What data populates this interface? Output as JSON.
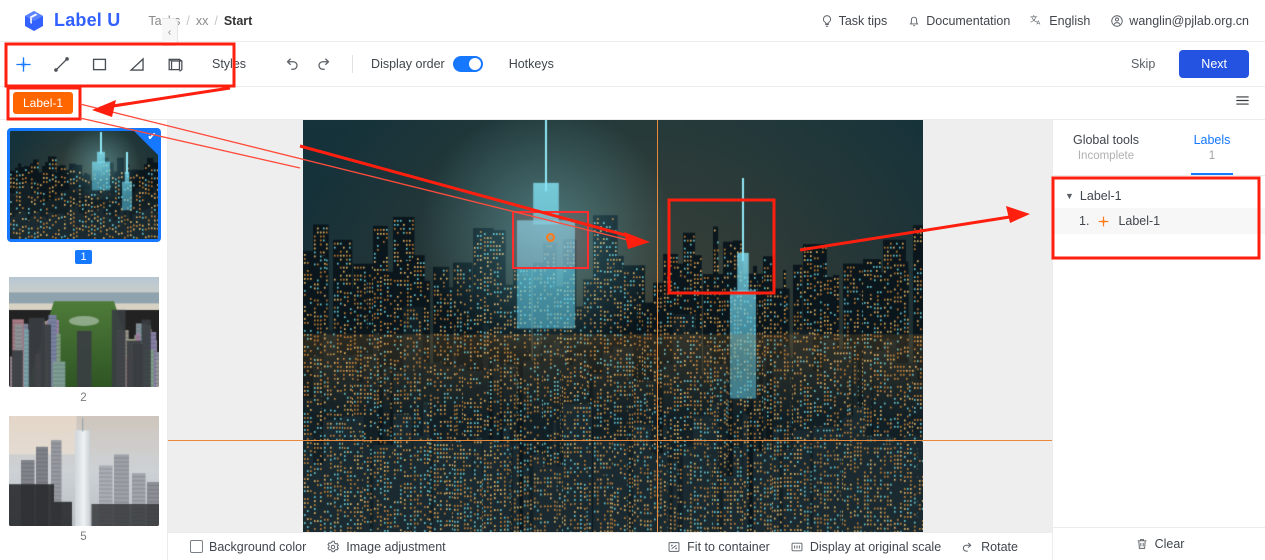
{
  "header": {
    "brand": "Label U",
    "logo_icon": "cube-logo-icon",
    "breadcrumb": {
      "root": "Tasks",
      "middle": "xx",
      "current": "Start",
      "separator": "/"
    },
    "actions": [
      {
        "label": "Task tips",
        "icon": "bulb-icon"
      },
      {
        "label": "Documentation",
        "icon": "bell-icon"
      },
      {
        "label": "English",
        "icon": "translate-icon"
      },
      {
        "label": "wanglin@pjlab.org.cn",
        "icon": "user-circle-icon"
      }
    ]
  },
  "toolbar": {
    "tools": [
      {
        "name": "point-tool",
        "icon": "crosshair-icon",
        "active": true
      },
      {
        "name": "line-tool",
        "icon": "line-icon",
        "active": false
      },
      {
        "name": "rect-tool",
        "icon": "rectangle-icon",
        "active": false
      },
      {
        "name": "polygon-tool",
        "icon": "polygon-icon",
        "active": false
      },
      {
        "name": "cuboid-tool",
        "icon": "cuboid-icon",
        "active": false
      }
    ],
    "styles_label": "Styles",
    "undo_icon": "undo-icon",
    "redo_icon": "redo-icon",
    "display_order_label": "Display order",
    "display_order_on": true,
    "hotkeys_label": "Hotkeys",
    "skip_label": "Skip",
    "next_label": "Next",
    "accent_color": "#2353e0"
  },
  "labelbar": {
    "active_label": "Label-1",
    "chip_color": "#ff6600",
    "menu_icon": "list-settings-icon"
  },
  "sidebar": {
    "collapse_icon": "chevron-left-icon",
    "thumbnails": [
      {
        "number": "1",
        "selected": true,
        "checked": true,
        "alt": "night city skyline"
      },
      {
        "number": "2",
        "selected": false,
        "checked": false,
        "alt": "central park aerial"
      },
      {
        "number": "5",
        "selected": false,
        "checked": false,
        "alt": "skyscrapers daytime"
      }
    ]
  },
  "canvas": {
    "crosshair_color": "#e8883a",
    "annotation": {
      "type": "point",
      "label": "Label-1",
      "marker_color": "#ff7a1a",
      "selection_color": "#ff2d2d"
    }
  },
  "bottombar": {
    "left": [
      {
        "label": "Background color",
        "icon": "color-square-icon"
      },
      {
        "label": "Image adjustment",
        "icon": "gear-icon"
      }
    ],
    "right": [
      {
        "label": "Fit to container",
        "icon": "fit-screen-icon"
      },
      {
        "label": "Display at original scale",
        "icon": "original-size-icon"
      },
      {
        "label": "Rotate",
        "icon": "rotate-icon"
      }
    ]
  },
  "rightpanel": {
    "tabs": [
      {
        "title": "Global tools",
        "sub": "Incomplete",
        "active": false
      },
      {
        "title": "Labels",
        "sub": "1",
        "active": true
      }
    ],
    "tree": {
      "group_label": "Label-1",
      "caret_icon": "caret-down-icon",
      "items": [
        {
          "index": "1.",
          "icon": "point-marker-icon",
          "label": "Label-1"
        }
      ]
    },
    "clear_label": "Clear",
    "clear_icon": "trash-icon"
  },
  "annotations_overlay": {
    "boxes": [
      {
        "name": "toolbar-highlight"
      },
      {
        "name": "label-chip-highlight"
      },
      {
        "name": "canvas-annotation-highlight"
      },
      {
        "name": "labels-tree-highlight"
      }
    ],
    "arrow_color": "#ff1f0f"
  }
}
